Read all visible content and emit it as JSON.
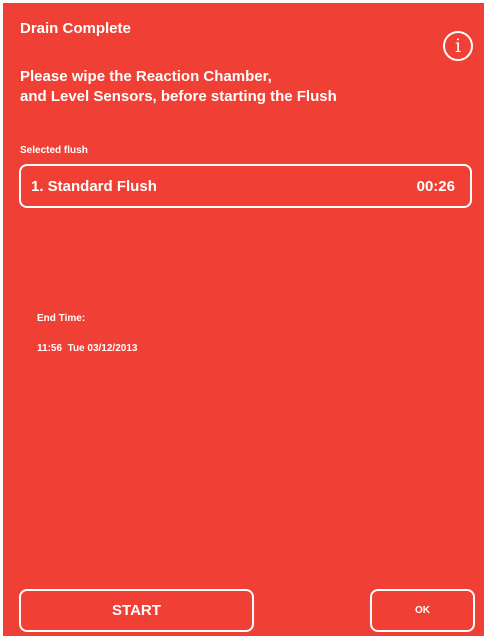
{
  "dialog": {
    "title": "Drain Complete",
    "info_icon": "info-icon",
    "info_glyph": "i",
    "message_line1": "Please wipe the Reaction Chamber,",
    "message_line2": "and Level Sensors, before starting the Flush"
  },
  "selected_flush": {
    "label": "Selected flush",
    "name": "1. Standard Flush",
    "duration": "00:26"
  },
  "end_time": {
    "label": "End Time:",
    "value": "11:56  Tue 03/12/2013"
  },
  "buttons": {
    "start_label": "START",
    "ok_label": "OK"
  },
  "colors": {
    "background": "#f03f34",
    "text": "#ffffff"
  }
}
